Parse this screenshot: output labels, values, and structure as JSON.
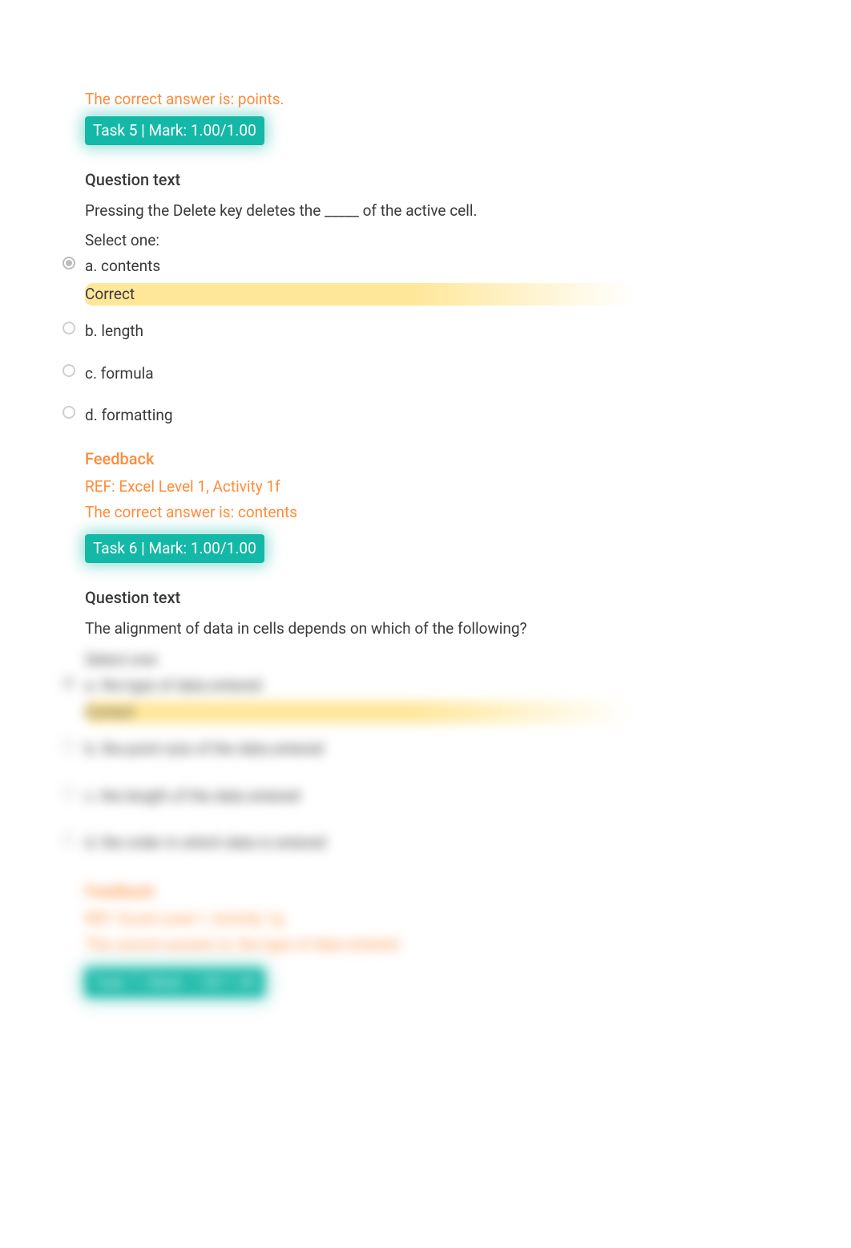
{
  "intro_correct_answer": "The correct answer is: points.",
  "task5": {
    "badge": "Task 5 | Mark: 1.00/1.00",
    "question_heading": "Question text",
    "question_text": "Pressing the Delete key deletes the _____ of the active cell.",
    "select_one": "Select one:",
    "options": {
      "a": "a. contents",
      "b": "b. length",
      "c": "c. formula",
      "d": "d. formatting"
    },
    "correct_label": "Correct",
    "feedback_heading": "Feedback",
    "feedback_ref": "REF: Excel Level 1, Activity 1f",
    "feedback_answer": "The correct answer is: contents"
  },
  "task6": {
    "badge": "Task 6 | Mark: 1.00/1.00",
    "question_heading": "Question text",
    "question_text": "The alignment of data in cells depends on which of the following?",
    "select_one": "Select one:",
    "options": {
      "a": "a. the type of data entered",
      "b": "b. the point size of the data entered",
      "c": "c. the length of the data entered",
      "d": "d. the order in which data is entered"
    },
    "correct_label": "Correct",
    "feedback_heading": "Feedback",
    "feedback_ref": "REF: Excel Level 1, Activity 1g",
    "feedback_answer": "The correct answer is: the type of data entered"
  },
  "task7": {
    "badge": "Task 7 | Mark: 1.00/1.00"
  }
}
